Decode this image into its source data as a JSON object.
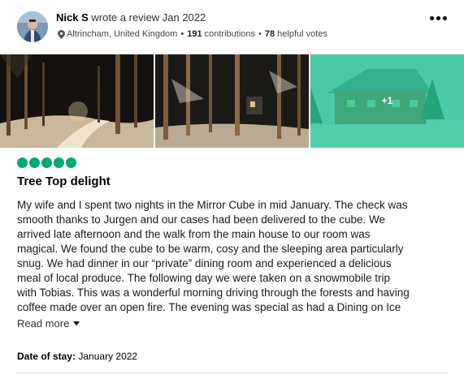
{
  "reviewer": {
    "name": "Nick S",
    "action": "wrote a review Jan 2022",
    "location": "Altrincham, United Kingdom",
    "contributions_count": "191",
    "contributions_label": "contributions",
    "helpful_count": "78",
    "helpful_label": "helpful votes"
  },
  "photos": {
    "more_count": "+1"
  },
  "rating": {
    "bubbles": 5,
    "max": 5,
    "color": "#00aa6c"
  },
  "review": {
    "title": "Tree Top delight",
    "lines": [
      "My wife and I spent two nights in the Mirror Cube in mid January. The check was",
      "smooth thanks to Jurgen and our cases had been delivered to the cube. We",
      "arrived late afternoon and the walk from the main house to our room was",
      "magical. We found the cube to be warm, cosy and the sleeping area particularly",
      "snug. We had dinner in our “private” dining room and experienced a delicious",
      "meal of local produce. The following day we were taken on a snowmobile trip",
      "with Tobias. This was a wonderful morning driving through the forests and having",
      "coffee made over an open fire. The evening was special as had a Dining on Ice"
    ],
    "read_more_label": "Read more"
  },
  "stay": {
    "label": "Date of stay:",
    "value": "January 2022"
  },
  "icons": {
    "more_options": "ellipsis-icon",
    "location": "map-pin-icon",
    "read_more": "caret-down-icon"
  }
}
